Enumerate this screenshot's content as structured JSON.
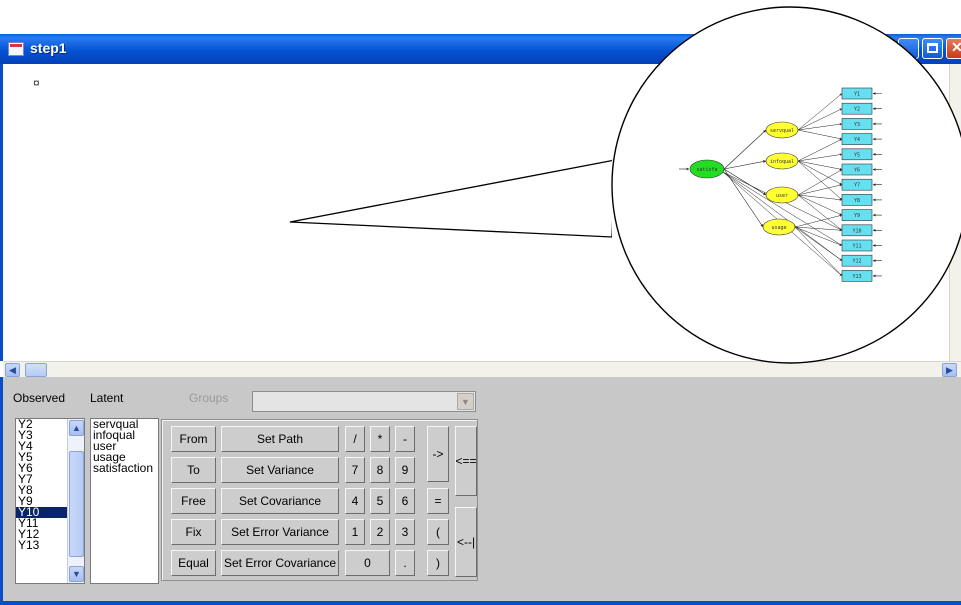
{
  "window": {
    "title": "step1"
  },
  "canvas": {
    "marker": "¤"
  },
  "panel": {
    "observed_label": "Observed",
    "latent_label": "Latent",
    "groups_label": "Groups",
    "observed_items": [
      "Y2",
      "Y3",
      "Y4",
      "Y5",
      "Y6",
      "Y7",
      "Y8",
      "Y9",
      "Y10",
      "Y11",
      "Y12",
      "Y13"
    ],
    "observed_selected": "Y10",
    "latent_items": [
      "servqual",
      "infoqual",
      "user",
      "usage",
      "satisfaction"
    ],
    "buttons": {
      "from": "From",
      "to": "To",
      "free": "Free",
      "fix": "Fix",
      "equal": "Equal",
      "set_path": "Set Path",
      "set_variance": "Set Variance",
      "set_covariance": "Set Covariance",
      "set_error_variance": "Set Error Variance",
      "set_error_covariance": "Set Error Covariance",
      "slash": "/",
      "star": "*",
      "minus": "-",
      "seven": "7",
      "eight": "8",
      "nine": "9",
      "four": "4",
      "five": "5",
      "six": "6",
      "one": "1",
      "two": "2",
      "three": "3",
      "zero": "0",
      "dot": ".",
      "arrow": "->",
      "equals": "=",
      "lparen": "(",
      "rparen": ")",
      "back_arrow": "<==",
      "back_bar": "<--|"
    }
  },
  "diagram": {
    "exogenous": "satisfa",
    "latents": [
      "servqual",
      "infoqual",
      "user",
      "usage"
    ],
    "indicators": [
      "Y1",
      "Y2",
      "Y3",
      "Y4",
      "Y5",
      "Y6",
      "Y7",
      "Y8",
      "Y9",
      "Y10",
      "Y11",
      "Y12",
      "Y13"
    ]
  },
  "colors": {
    "titlebar": "#0552d3",
    "exogenous_fill": "#22dd22",
    "latent_fill": "#ffff33",
    "indicator_fill": "#66e0f0",
    "selection": "#0a246a"
  }
}
